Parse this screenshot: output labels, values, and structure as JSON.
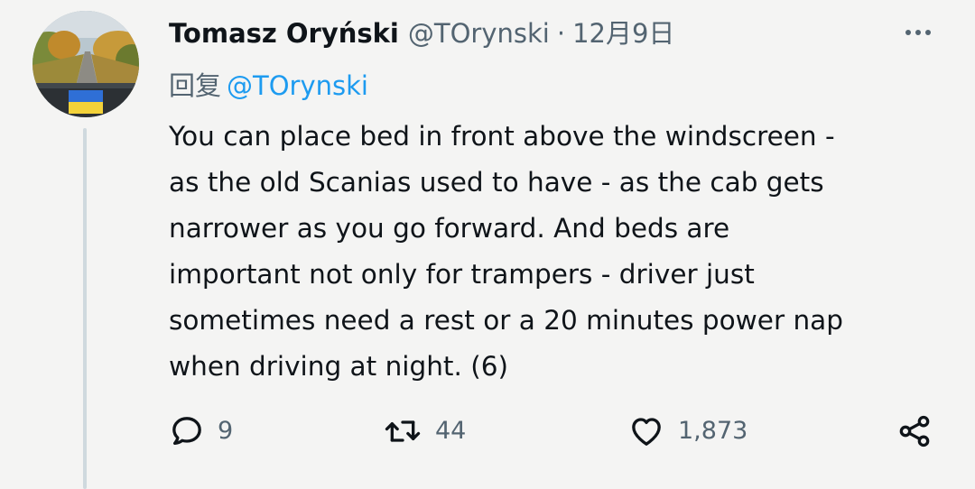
{
  "tweet": {
    "author": {
      "display_name": "Tomasz Oryński",
      "handle": "@TOrynski"
    },
    "separator": "·",
    "date": "12月9日",
    "reply_label": "回复",
    "reply_to": "@TOrynski",
    "text": "You can place bed in front above the windscreen -\nas the old Scanias used to have - as the cab gets\nnarrower as you go forward. And beds are\nimportant not only for trampers - driver just\nsometimes need a rest or a 20 minutes power nap\nwhen driving at night. (6)",
    "actions": {
      "reply_count": "9",
      "retweet_count": "44",
      "like_count": "1,873"
    }
  },
  "icons": {
    "more": "more-horizontal-icon",
    "reply": "reply-bubble-icon",
    "retweet": "retweet-icon",
    "like": "heart-icon",
    "share": "share-icon"
  },
  "colors": {
    "background": "#f4f4f3",
    "text_primary": "#0f1419",
    "text_secondary": "#536471",
    "link": "#1d9bf0",
    "flag_blue": "#2f6fd6",
    "flag_yellow": "#f3d23a"
  }
}
